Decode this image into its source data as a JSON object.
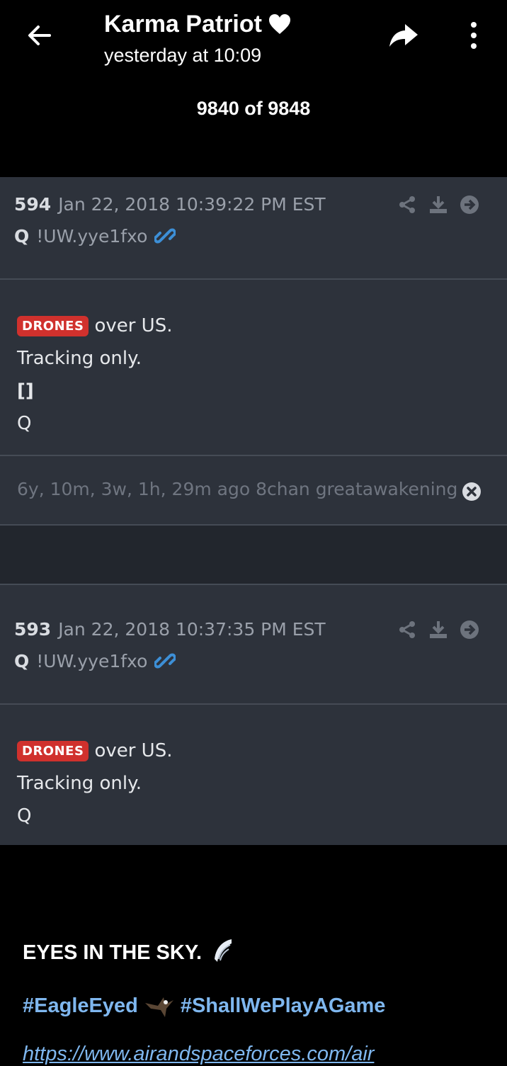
{
  "header": {
    "sender": "Karma Patriot",
    "time": "yesterday at 10:09",
    "counter": "9840 of 9848",
    "heart_color": "#ffffff"
  },
  "posts": [
    {
      "number": "594",
      "date": "Jan 22, 2018 10:39:22 PM EST",
      "author": "Q",
      "tripcode": "!UW.yye1fxo",
      "tag": "DRONES",
      "line1": "over US.",
      "line2": "Tracking only.",
      "line3": "[]",
      "line4": "Q",
      "footer": "6y, 10m, 3w, 1h, 29m ago  8chan greatawakening"
    },
    {
      "number": "593",
      "date": "Jan 22, 2018 10:37:35 PM EST",
      "author": "Q",
      "tripcode": "!UW.yye1fxo",
      "tag": "DRONES",
      "line1": "over US.",
      "line2": "Tracking only.",
      "line3": "Q"
    }
  ],
  "caption": {
    "text": "EYES IN THE SKY.",
    "hashtag1": "#EagleEyed",
    "hashtag2": "#ShallWePlayAGame",
    "link": "https://www.airandspaceforces.com/air"
  },
  "colors": {
    "panel": "#2d323b",
    "tag": "#d0312d",
    "link": "#7fb7ef",
    "chain_link": "#3d8fd6"
  }
}
